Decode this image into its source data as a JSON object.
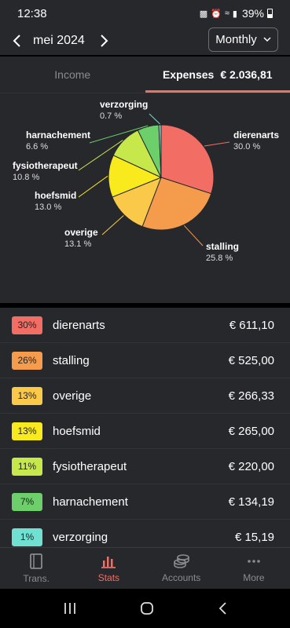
{
  "status": {
    "time": "12:38",
    "battery": "39%"
  },
  "header": {
    "month": "mei 2024",
    "period": "Monthly"
  },
  "tabs": [
    {
      "label": "Income",
      "amount": ""
    },
    {
      "label": "Expenses",
      "amount": "€ 2.036,81"
    }
  ],
  "chart_data": {
    "type": "pie",
    "title": "",
    "slices": [
      {
        "label": "dierenarts",
        "percent_label": "30.0 %",
        "value": 30.0,
        "color": "#f26d64"
      },
      {
        "label": "stalling",
        "percent_label": "25.8 %",
        "value": 25.8,
        "color": "#f59b4c"
      },
      {
        "label": "overige",
        "percent_label": "13.1 %",
        "value": 13.1,
        "color": "#fbc94a"
      },
      {
        "label": "hoefsmid",
        "percent_label": "13.0 %",
        "value": 13.0,
        "color": "#f9ea1d"
      },
      {
        "label": "fysiotherapeut",
        "percent_label": "10.8 %",
        "value": 10.8,
        "color": "#c6e84b"
      },
      {
        "label": "harnachement",
        "percent_label": "6.6 %",
        "value": 6.6,
        "color": "#6ccf6a"
      },
      {
        "label": "verzorging",
        "percent_label": "0.7 %",
        "value": 0.7,
        "color": "#6fe0d2"
      }
    ]
  },
  "list": [
    {
      "pct": "30%",
      "name": "dierenarts",
      "amount": "€ 611,10",
      "color": "#f26d64"
    },
    {
      "pct": "26%",
      "name": "stalling",
      "amount": "€ 525,00",
      "color": "#f59b4c"
    },
    {
      "pct": "13%",
      "name": "overige",
      "amount": "€ 266,33",
      "color": "#fbc94a"
    },
    {
      "pct": "13%",
      "name": "hoefsmid",
      "amount": "€ 265,00",
      "color": "#f9ea1d"
    },
    {
      "pct": "11%",
      "name": "fysiotherapeut",
      "amount": "€ 220,00",
      "color": "#c6e84b"
    },
    {
      "pct": "7%",
      "name": "harnachement",
      "amount": "€ 134,19",
      "color": "#6ccf6a"
    },
    {
      "pct": "1%",
      "name": "verzorging",
      "amount": "€ 15,19",
      "color": "#6fe0d2"
    }
  ],
  "bottom_nav": [
    {
      "label": "Trans.",
      "icon": "book-icon"
    },
    {
      "label": "Stats",
      "icon": "bar-chart-icon"
    },
    {
      "label": "Accounts",
      "icon": "coins-icon"
    },
    {
      "label": "More",
      "icon": "more-dots-icon"
    }
  ]
}
